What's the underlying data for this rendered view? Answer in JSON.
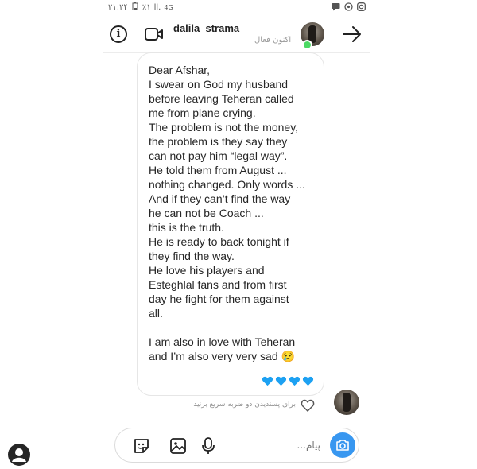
{
  "status_bar": {
    "time": "۲۱:۲۴",
    "battery": "٪۱",
    "signal": "ll.",
    "network": "4G"
  },
  "header": {
    "username": "dalila_strama",
    "active_status": "اکنون فعال"
  },
  "message": {
    "lines": [
      "Dear Afshar,",
      "I swear on God my husband",
      "before leaving Teheran called",
      "me from plane crying.",
      "The problem is not the money,",
      "the problem is they say they",
      "can not pay him “legal way”.",
      "He told them from August ...",
      "nothing changed. Only words ...",
      "And if they can’t find the way",
      "he can not be Coach ...",
      "this is the truth.",
      "He is ready to back tonight if",
      "they find the way.",
      "He love his players and",
      "Esteghlal fans and from first",
      "day he fight for them against",
      "all.",
      "",
      "I am also in love with Teheran",
      "and I’m also very very sad 😢"
    ],
    "reaction": "💙💙💙💙"
  },
  "like_hint": "برای پسندیدن دو ضربه سریع بزنید",
  "composer": {
    "placeholder": "پیام..."
  },
  "colors": {
    "accent": "#3897f0",
    "online": "#4cd964",
    "heart_blue": "#1da1f2"
  },
  "icons": {
    "info": "info-icon",
    "video": "video-call-icon",
    "back": "arrow-right-icon",
    "like": "heart-outline-icon",
    "sticker": "sticker-icon",
    "gallery": "image-icon",
    "mic": "microphone-icon",
    "camera": "camera-icon"
  }
}
